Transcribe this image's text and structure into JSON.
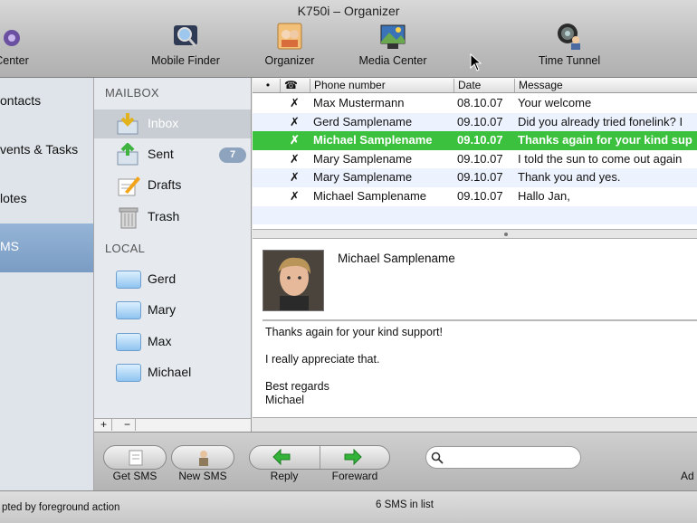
{
  "window": {
    "title": "K750i – Organizer"
  },
  "toolbar": {
    "items": [
      {
        "label": "Center",
        "icon": "media-center-icon"
      },
      {
        "label": "Mobile Finder",
        "icon": "mobile-finder-icon"
      },
      {
        "label": "Organizer",
        "icon": "organizer-icon"
      },
      {
        "label": "Media Center",
        "icon": "media-center-icon"
      },
      {
        "label": "Time Tunnel",
        "icon": "time-tunnel-icon"
      }
    ]
  },
  "sidebar": {
    "items": [
      {
        "label": "ontacts"
      },
      {
        "label": "vents & Tasks"
      },
      {
        "label": "lotes"
      },
      {
        "label": "MS"
      }
    ],
    "selected_index": 3
  },
  "mailbox": {
    "section_mailbox": "MAILBOX",
    "section_local": "LOCAL",
    "folders": [
      {
        "label": "Inbox",
        "icon": "inbox-icon"
      },
      {
        "label": "Sent",
        "icon": "sent-icon",
        "badge": "7"
      },
      {
        "label": "Drafts",
        "icon": "drafts-icon"
      },
      {
        "label": "Trash",
        "icon": "trash-icon"
      }
    ],
    "local": [
      {
        "label": "Gerd"
      },
      {
        "label": "Mary"
      },
      {
        "label": "Max"
      },
      {
        "label": "Michael"
      }
    ],
    "add_label": "+",
    "remove_label": "−"
  },
  "list": {
    "columns": {
      "status": "•",
      "phone_icon": "☎",
      "phone": "Phone number",
      "date": "Date",
      "message": "Message"
    },
    "rows": [
      {
        "mark": "✗",
        "name": "Max Mustermann",
        "date": "08.10.07",
        "message": "Your welcome"
      },
      {
        "mark": "✗",
        "name": "Gerd Samplename",
        "date": "09.10.07",
        "message": "Did you already tried fonelink? I"
      },
      {
        "mark": "✗",
        "name": "Michael Samplename",
        "date": "09.10.07",
        "message": "Thanks again for your kind sup"
      },
      {
        "mark": "✗",
        "name": "Mary Samplename",
        "date": "09.10.07",
        "message": "I told the sun to come out again"
      },
      {
        "mark": "✗",
        "name": "Mary Samplename",
        "date": "09.10.07",
        "message": "Thank you and yes."
      },
      {
        "mark": "✗",
        "name": "Michael Samplename",
        "date": "09.10.07",
        "message": "Hallo Jan,"
      }
    ],
    "selected_index": 2
  },
  "preview": {
    "sender": "Michael Samplename",
    "line1": "Thanks again for your kind support!",
    "line2": "I really appreciate that.",
    "line3": "Best regards",
    "line4": "Michael"
  },
  "bottom": {
    "get_sms": "Get SMS",
    "new_sms": "New SMS",
    "reply": "Reply",
    "forward": "Foreward",
    "right_cut": "Ad",
    "search_placeholder": ""
  },
  "status": {
    "left": "pted by foreground action",
    "center": "6 SMS in list"
  },
  "colors": {
    "selected_row": "#3bc13d",
    "sidebar_selected": "#7a9cc4",
    "badge": "#8ea3bd"
  }
}
